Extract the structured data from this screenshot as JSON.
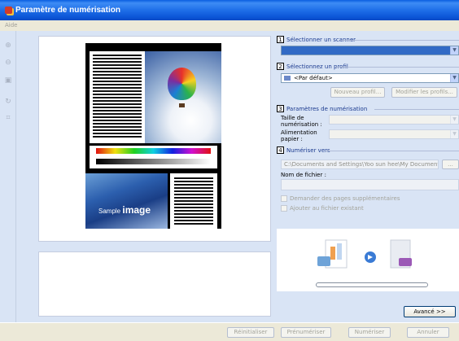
{
  "window": {
    "title": "Paramètre de numérisation"
  },
  "menu": {
    "help": "Aide"
  },
  "toolbar": {
    "icons": [
      "zoom-in-icon",
      "zoom-out-icon",
      "fit-page-icon",
      "rotate-icon",
      "crop-icon"
    ]
  },
  "preview": {
    "sample_text_prefix": "Sample ",
    "sample_text_bold": "image"
  },
  "sections": {
    "scanner": {
      "number": "1",
      "title": "Sélectionner un scanner",
      "value": ""
    },
    "profile": {
      "number": "2",
      "title": "Sélectionnez un profil",
      "value": "<Par défaut>",
      "new_button": "Nouveau profil...",
      "edit_button": "Modifier les profils..."
    },
    "scan_params": {
      "number": "3",
      "title": "Paramètres de numérisation",
      "size_label": "Taille de numérisation :",
      "feed_label": "Alimentation papier :"
    },
    "scan_to": {
      "number": "4",
      "title": "Numériser vers",
      "path": "C:\\Documents and Settings\\Yoo sun hee\\My Documents",
      "browse_button": "...",
      "filename_label": "Nom de fichier :",
      "filename_value": "",
      "more_pages": "Demander des pages supplémentaires",
      "append": "Ajouter au fichier existant"
    }
  },
  "advanced_button": "Avancé >>",
  "footer": {
    "reset": "Réinitialiser",
    "prescan": "Prénumériser",
    "scan": "Numériser",
    "cancel": "Annuler"
  },
  "colors": {
    "title_blue": "#0a5fe0",
    "selection_blue": "#316ac5",
    "panel_bg": "#d9e4f5"
  }
}
